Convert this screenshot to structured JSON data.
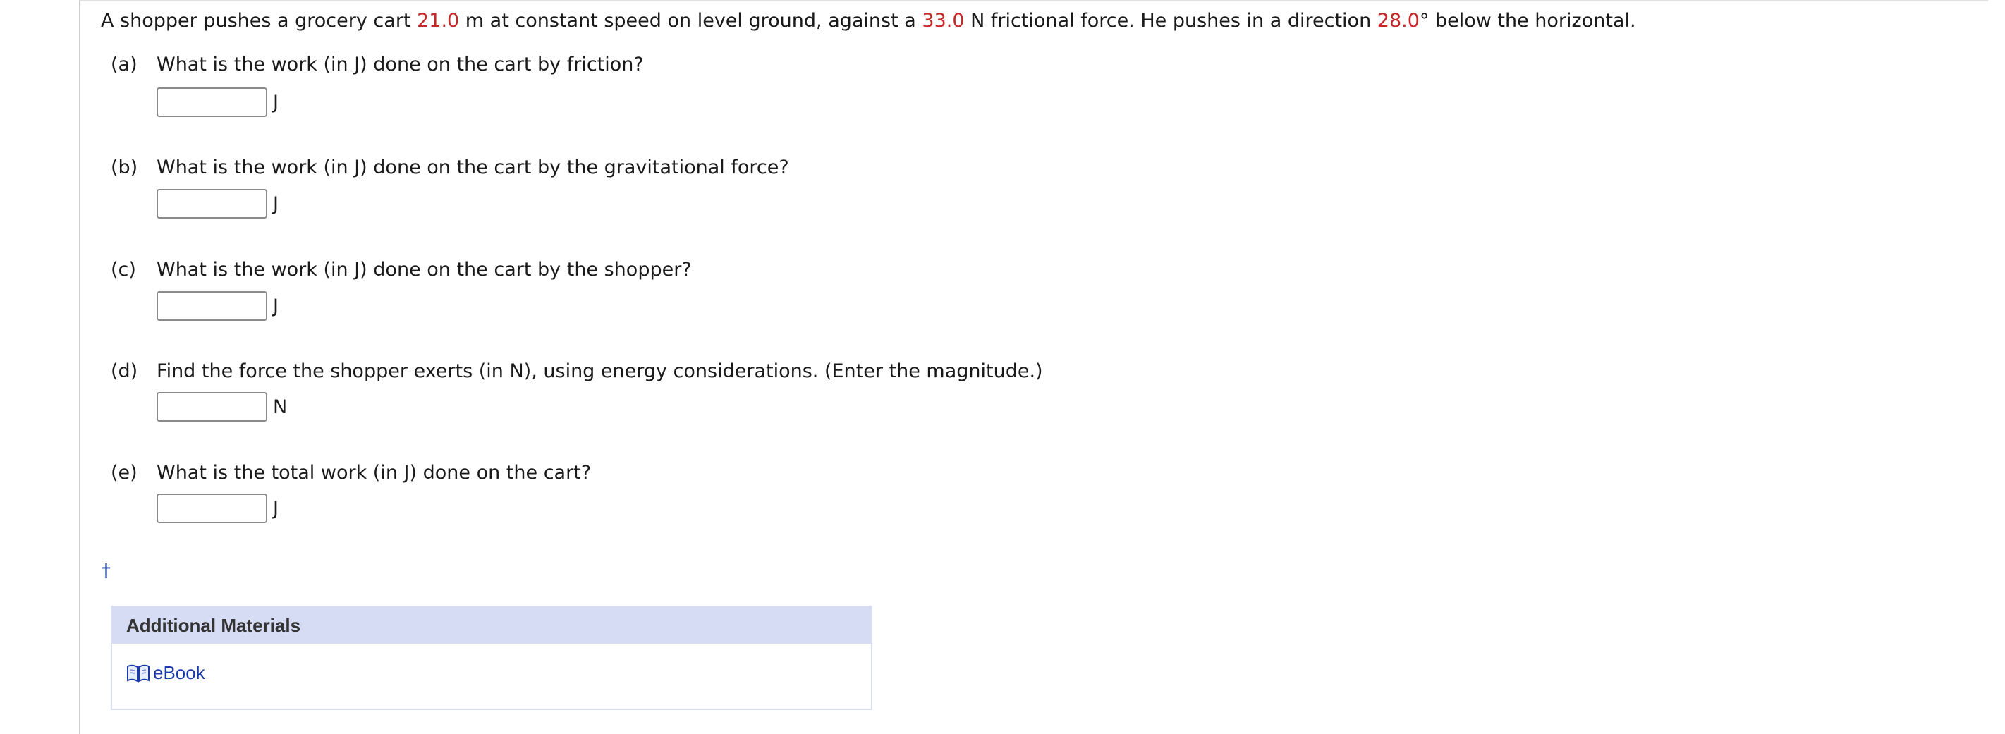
{
  "problem": {
    "text_1": "A shopper pushes a grocery cart ",
    "distance": "21.0",
    "text_2": " m at constant speed on level ground, against a ",
    "friction": "33.0",
    "text_3": " N frictional force. He pushes in a direction ",
    "angle": "28.0",
    "text_4": "° below the horizontal."
  },
  "parts": [
    {
      "letter": "(a)",
      "question": "What is the work (in J) done on the cart by friction?",
      "unit": "J",
      "value": ""
    },
    {
      "letter": "(b)",
      "question": "What is the work (in J) done on the cart by the gravitational force?",
      "unit": "J",
      "value": ""
    },
    {
      "letter": "(c)",
      "question": "What is the work (in J) done on the cart by the shopper?",
      "unit": "J",
      "value": ""
    },
    {
      "letter": "(d)",
      "question": "Find the force the shopper exerts (in N), using energy considerations. (Enter the magnitude.)",
      "unit": "N",
      "value": ""
    },
    {
      "letter": "(e)",
      "question": "What is the total work (in J) done on the cart?",
      "unit": "J",
      "value": ""
    }
  ],
  "footnote_marker": "†",
  "additional_materials": {
    "title": "Additional Materials",
    "ebook_label": "eBook"
  },
  "colors": {
    "given_value": "#c62828",
    "link": "#1a3aa8",
    "materials_header_bg": "#d6dcf4"
  },
  "icons": {
    "ebook": "book-icon"
  }
}
